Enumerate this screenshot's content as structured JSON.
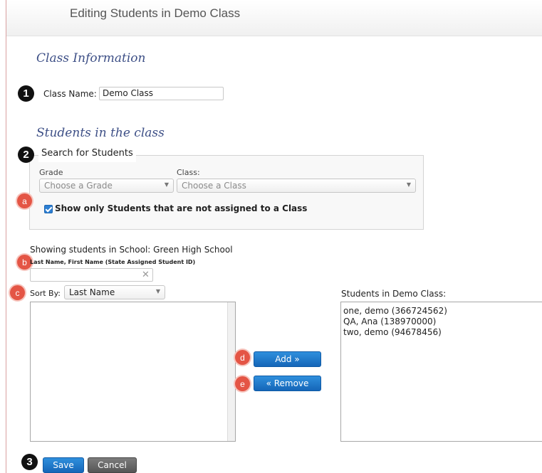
{
  "header": {
    "title": "Editing Students in Demo Class"
  },
  "class_info": {
    "section_title": "Class Information",
    "marker": "1",
    "class_name_label": "Class Name:",
    "class_name_value": "Demo Class"
  },
  "students": {
    "section_title": "Students in the class",
    "marker": "2",
    "search_legend": "Search for Students",
    "grade_label": "Grade",
    "grade_placeholder": "Choose a Grade",
    "class_label": "Class:",
    "class_placeholder": "Choose a Class",
    "marker_a": "a",
    "unassigned_checkbox_label": "Show only Students that are not assigned to a Class",
    "unassigned_checked": true,
    "school_text": "Showing students in School: Green High School",
    "marker_b": "b",
    "name_search_label": "Last Name, First Name (State Assigned Student ID)",
    "name_search_value": "",
    "marker_c": "c",
    "sort_label": "Sort By:",
    "sort_value": "Last Name",
    "available_students": [],
    "class_list_label": "Students in Demo Class:",
    "class_students": [
      "one, demo (366724562)",
      "QA, Ana (138970000)",
      "two, demo (94678456)"
    ],
    "marker_d": "d",
    "add_label": "Add »",
    "marker_e": "e",
    "remove_label": "« Remove"
  },
  "footer": {
    "marker": "3",
    "save_label": "Save",
    "cancel_label": "Cancel"
  },
  "colors": {
    "accent_blue": "#1a73c4",
    "section_title": "#3d4f86",
    "marker_red": "#e45545",
    "marker_black": "#111111"
  }
}
